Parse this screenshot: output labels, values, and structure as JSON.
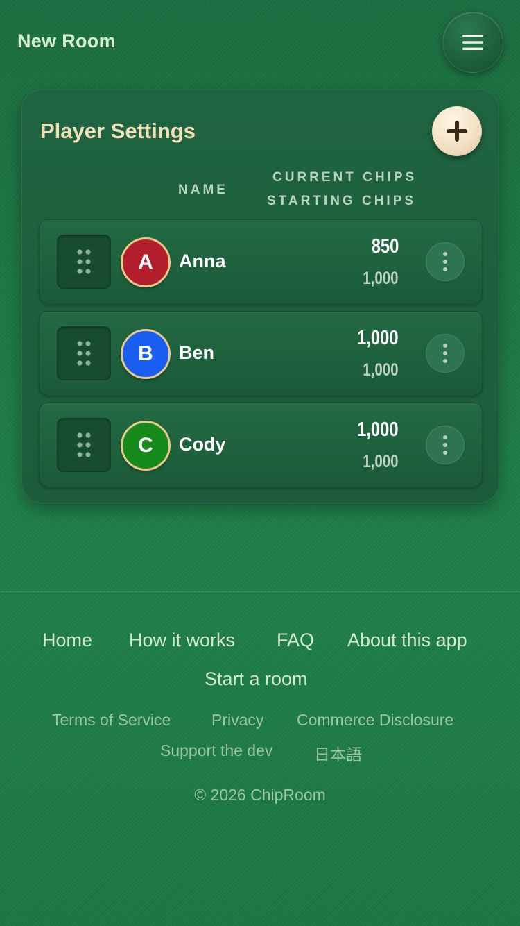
{
  "header": {
    "title": "New Room",
    "menu_icon": "hamburger-icon"
  },
  "card": {
    "title": "Player Settings",
    "add_icon": "plus-icon",
    "columns": {
      "name": "NAME",
      "current_chips": "CURRENT CHIPS",
      "starting_chips": "STARTING CHIPS"
    },
    "players": [
      {
        "initial": "A",
        "name": "Anna",
        "current": "850",
        "starting": "1,000",
        "color": "#b31e2c"
      },
      {
        "initial": "B",
        "name": "Ben",
        "current": "1,000",
        "starting": "1,000",
        "color": "#1a5ef0"
      },
      {
        "initial": "C",
        "name": "Cody",
        "current": "1,000",
        "starting": "1,000",
        "color": "#178a1c"
      }
    ]
  },
  "footer": {
    "nav": [
      "Home",
      "How it works",
      "FAQ",
      "About this app",
      "Start a room"
    ],
    "legal": [
      "Terms of Service",
      "Privacy",
      "Commerce Disclosure",
      "Support the dev",
      "日本語"
    ],
    "copyright": "© 2026 ChipRoom"
  },
  "colors": {
    "background": "#1d7a45",
    "card": "#1f6440",
    "accent_gold": "#f1dfb8"
  }
}
